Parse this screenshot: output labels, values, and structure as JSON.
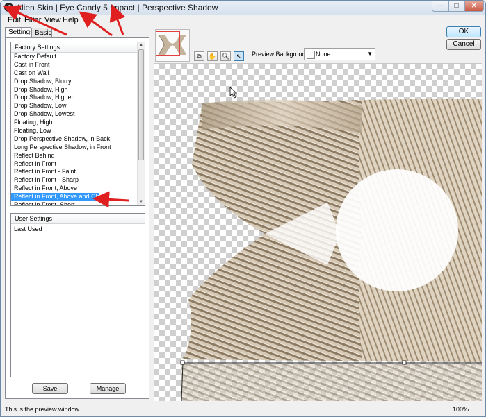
{
  "window": {
    "title": "Alien Skin | Eye Candy 5 Impact | Perspective Shadow",
    "controls": {
      "minimize": "—",
      "maximize": "□",
      "close": "✕"
    }
  },
  "menu": [
    "Edit",
    "Filter",
    "View",
    "Help"
  ],
  "tabs": {
    "settings": "Settings",
    "basic": "Basic"
  },
  "factory": {
    "header": "Factory Settings",
    "items": [
      "Factory Default",
      "Cast in Front",
      "Cast on Wall",
      "Drop Shadow, Blurry",
      "Drop Shadow, High",
      "Drop Shadow, Higher",
      "Drop Shadow, Low",
      "Drop Shadow, Lowest",
      "Floating, High",
      "Floating, Low",
      "Drop Perspective Shadow, in Back",
      "Long Perspective Shadow, in Front",
      "Reflect Behind",
      "Reflect in Front",
      "Reflect in Front - Faint",
      "Reflect in Front - Sharp",
      "Reflect in Front, Above",
      "Reflect in Front, Above and Close",
      "Reflect in Front, Short"
    ],
    "selected_index": 17
  },
  "user": {
    "header": "User Settings",
    "items": [
      "Last Used"
    ]
  },
  "buttons": {
    "save": "Save",
    "manage": "Manage",
    "ok": "OK",
    "cancel": "Cancel"
  },
  "toolbar": {
    "preview_background_label": "Preview Background:",
    "preview_background_value": "None",
    "tools": [
      "compare-icon",
      "hand-icon",
      "zoom-icon",
      "pointer-icon"
    ]
  },
  "status": {
    "text": "This is the preview window",
    "zoom": "100%"
  },
  "colors": {
    "selection": "#3399ff",
    "annotation": "#e02020",
    "metal": "#c9b9a3"
  }
}
